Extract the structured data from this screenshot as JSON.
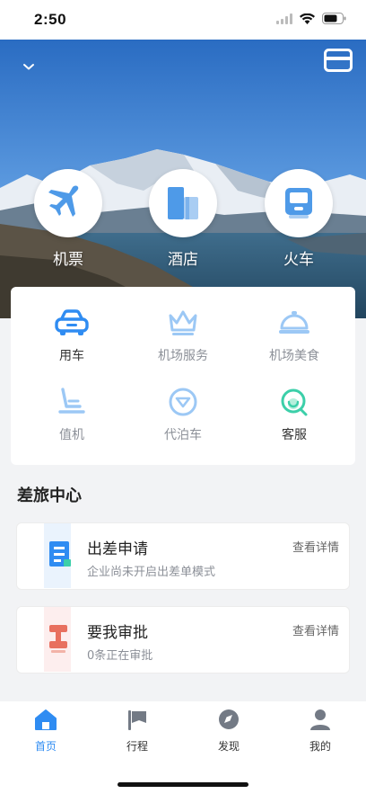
{
  "status_bar": {
    "time": "2:50"
  },
  "hero": {
    "services": [
      {
        "label": "机票",
        "icon": "airplane-icon"
      },
      {
        "label": "酒店",
        "icon": "hotel-building-icon"
      },
      {
        "label": "火车",
        "icon": "train-icon"
      }
    ]
  },
  "grid": {
    "items": [
      {
        "label": "用车",
        "icon": "car-icon"
      },
      {
        "label": "机场服务",
        "icon": "crown-icon"
      },
      {
        "label": "机场美食",
        "icon": "food-cloche-icon"
      },
      {
        "label": "值机",
        "icon": "seat-icon"
      },
      {
        "label": "代泊车",
        "icon": "valet-parking-icon"
      },
      {
        "label": "客服",
        "icon": "customer-service-icon"
      }
    ]
  },
  "travel_center": {
    "title": "差旅中心",
    "cards": [
      {
        "title": "出差申请",
        "subtitle": "企业尚未开启出差单模式",
        "link": "查看详情",
        "icon": "trip-request-icon"
      },
      {
        "title": "要我审批",
        "subtitle_count": "0",
        "subtitle_text": "条正在审批",
        "link": "查看详情",
        "icon": "approval-stamp-icon"
      }
    ]
  },
  "tab_bar": {
    "tabs": [
      {
        "label": "首页",
        "icon": "home-icon",
        "active": true
      },
      {
        "label": "行程",
        "icon": "flag-icon",
        "active": false
      },
      {
        "label": "发现",
        "icon": "compass-icon",
        "active": false
      },
      {
        "label": "我的",
        "icon": "user-icon",
        "active": false
      }
    ]
  },
  "colors": {
    "accent": "#2f8cf2",
    "light_accent": "#9cc8f5",
    "teal": "#3ccfa9",
    "stamp_red": "#e8705f"
  }
}
